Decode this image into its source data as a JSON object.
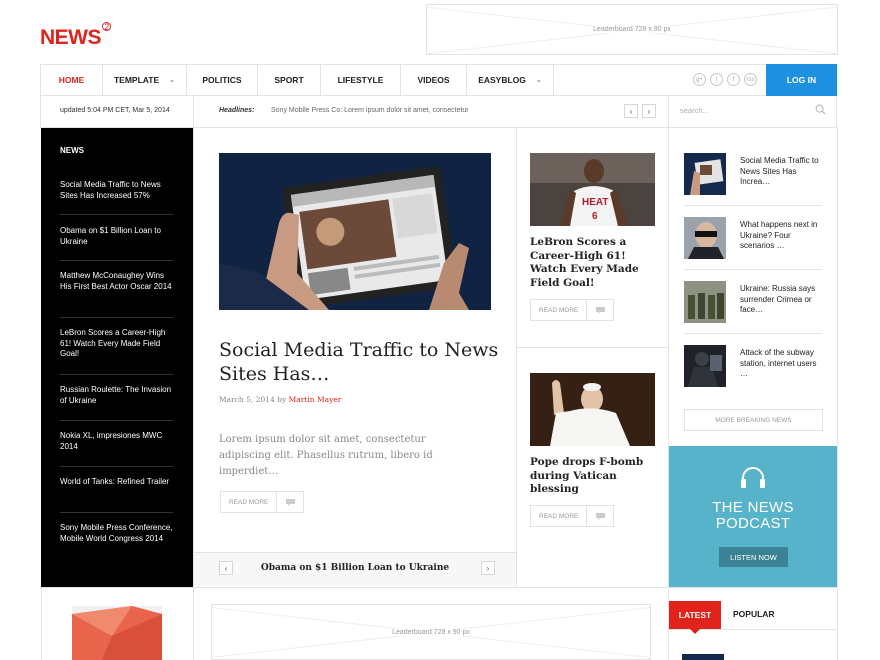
{
  "header": {
    "logo": "NEWS",
    "logo_badge": "2",
    "leaderboard_top": "Leaderboard  728 x 90 px",
    "leaderboard_bottom": "Leaderboard  728 x 90 px"
  },
  "nav": {
    "items": [
      {
        "label": "HOME",
        "active": true,
        "dropdown": false
      },
      {
        "label": "TEMPLATE",
        "active": false,
        "dropdown": true
      },
      {
        "label": "POLITICS",
        "active": false,
        "dropdown": false
      },
      {
        "label": "SPORT",
        "active": false,
        "dropdown": false
      },
      {
        "label": "LIFESTYLE",
        "active": false,
        "dropdown": false
      },
      {
        "label": "VIDEOS",
        "active": false,
        "dropdown": false
      },
      {
        "label": "EASYBLOG",
        "active": false,
        "dropdown": true
      }
    ],
    "social": [
      "g+",
      "t",
      "f",
      "rss"
    ],
    "login_label": "LOG IN"
  },
  "ticker": {
    "updated": "updated 5:04 PM CET, Mar 5, 2014",
    "headlines_label": "Headlines:",
    "headline_text": "Sony Mobile Press Co: Lorem ipsum dolor sit amet, consectetur",
    "prev": "‹",
    "next": "›"
  },
  "search": {
    "placeholder": "search..."
  },
  "sidebar": {
    "title": "NEWS",
    "items": [
      "Social Media Traffic to News Sites Has Increased 57%",
      "Obama on $1 Billion Loan to Ukraine",
      "Matthew McConaughey Wins His First Best Actor Oscar 2014",
      "LeBron Scores a Career-High 61! Watch Every Made Field Goal!",
      "Russian Roulette: The Invasion of Ukraine",
      "Nokia XL, impresiones MWC 2014",
      "World of Tanks: Refined Trailer",
      "Sony Mobile Press Conference, Mobile World Congress 2014"
    ]
  },
  "main": {
    "title": "Social Media Traffic to News Sites Has…",
    "date": "March 5, 2014 by",
    "author": "Martin Mayer",
    "excerpt": "Lorem ipsum dolor sit amet, consectetur adipiscing elit. Phasellus rutrum, libero id imperdiet…",
    "read_more": "READ MORE",
    "slider_text": "Obama on $1 Billion Loan to Ukraine"
  },
  "middle": {
    "story1_title": "LeBron Scores a Career-High 61! Watch Every Made Field Goal!",
    "story2_title": "Pope drops F-bomb during Vatican blessing",
    "read_more": "READ MORE"
  },
  "right": {
    "items": [
      "Social Media Traffic to News Sites Has Increa…",
      "What happens next in Ukraine? Four scenarios …",
      "Ukraine: Russia says surrender Crimea or face…",
      "Attack of the subway station, internet users …"
    ],
    "more_label": "MORE BREAKING NEWS",
    "podcast_line1": "THE NEWS",
    "podcast_line2": "PODCAST",
    "listen_label": "LISTEN NOW",
    "tab_latest": "LATEST",
    "tab_popular": "POPULAR"
  },
  "colors": {
    "accent": "#e0231b",
    "login": "#1e90e0",
    "podcast": "#56b3c9"
  }
}
